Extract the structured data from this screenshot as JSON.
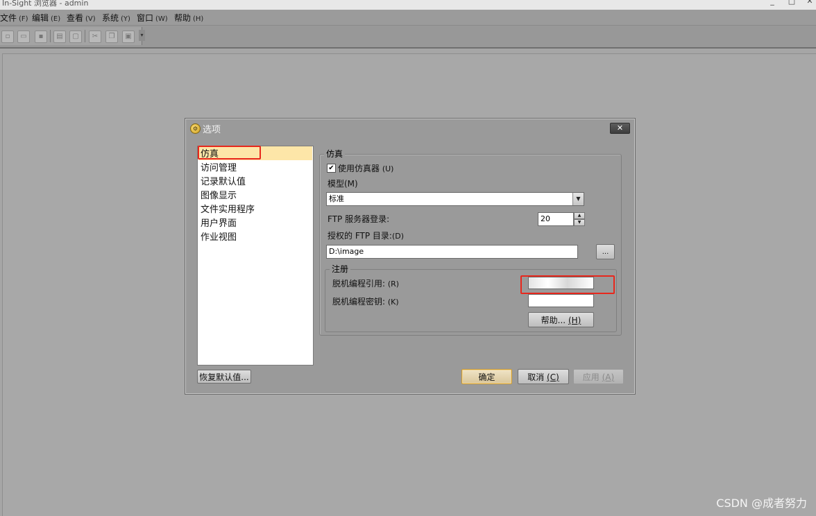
{
  "window": {
    "title": "In-Sight 浏览器 - admin",
    "controls": [
      "_",
      "□",
      "✕"
    ]
  },
  "menubar": [
    {
      "label": "文件",
      "accel": "(F)"
    },
    {
      "label": "编辑",
      "accel": "(E)"
    },
    {
      "label": "查看",
      "accel": "(V)"
    },
    {
      "label": "系统",
      "accel": "(Y)"
    },
    {
      "label": "窗口",
      "accel": "(W)"
    },
    {
      "label": "帮助",
      "accel": "(H)"
    }
  ],
  "toolbar": {
    "icons": [
      "new-icon",
      "open-icon",
      "save-icon",
      "print-icon",
      "print-preview-icon",
      "cut-icon",
      "copy-icon",
      "paste-icon"
    ],
    "overflow_icon": "▾"
  },
  "dialog": {
    "title": "选项",
    "close_label": "✕",
    "categories": [
      "仿真",
      "访问管理",
      "记录默认值",
      "图像显示",
      "文件实用程序",
      "用户界面",
      "作业视图"
    ],
    "selected_category": "仿真",
    "restore_defaults_label": "恢复默认值...",
    "ok_label": "确定",
    "cancel_label": "取消",
    "cancel_accel": "(C)",
    "apply_label": "应用",
    "apply_accel": "(A)",
    "simulation": {
      "group_title": "仿真",
      "use_emulator_label": "使用仿真器",
      "use_emulator_accel": "(U)",
      "use_emulator_checked": true,
      "model_label": "模型(M)",
      "model_value": "标准",
      "ftp_login_label": "FTP 服务器登录:",
      "ftp_login_value": "20",
      "ftp_dir_label": "授权的 FTP 目录:",
      "ftp_dir_accel": "(D)",
      "ftp_dir_value": "D:\\image",
      "browse_label": "..."
    },
    "register": {
      "group_title": "注册",
      "offline_ref_label": "脱机编程引用:",
      "offline_ref_accel": "(R)",
      "offline_ref_value": "",
      "offline_key_label": "脱机编程密钥:",
      "offline_key_accel": "(K)",
      "offline_key_value": "",
      "help_label": "帮助...",
      "help_accel": "(H)"
    }
  },
  "watermark": "CSDN @成者努力",
  "colors": {
    "highlight": "#e8271c",
    "selection": "#fde6a8",
    "background": "#a6a6a6"
  }
}
